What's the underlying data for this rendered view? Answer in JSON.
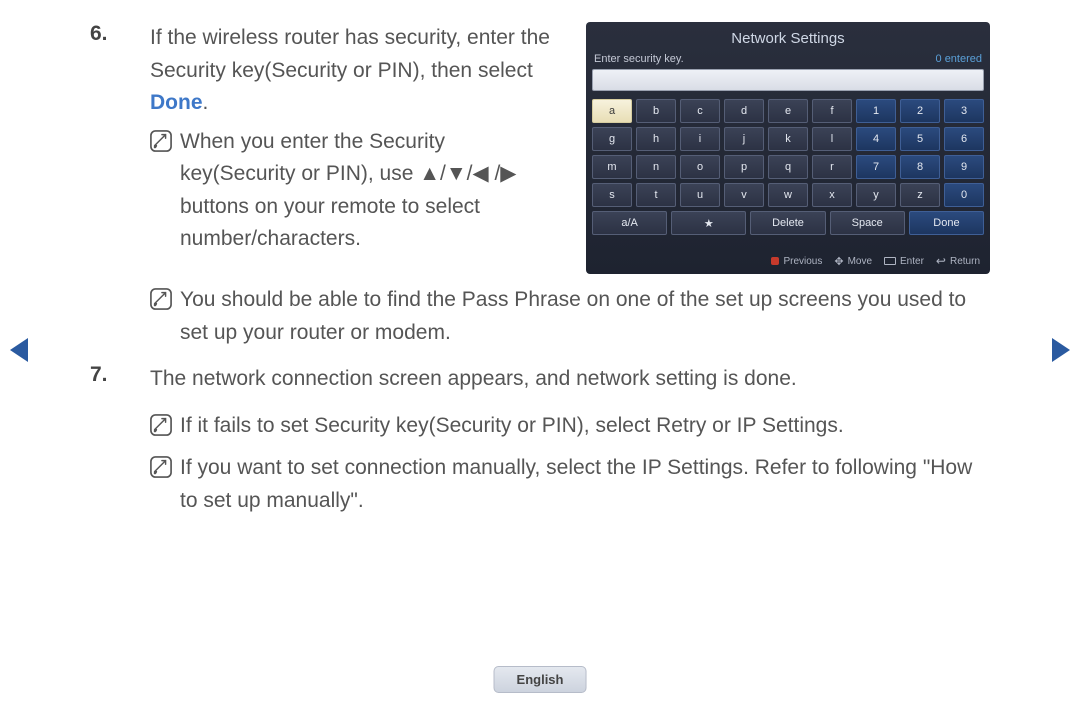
{
  "nav": {
    "prev": "◀",
    "next": "▶"
  },
  "step6": {
    "num": "6.",
    "text_a": "If the wireless router has security, enter the Security key(Security or PIN), then select ",
    "text_done": "Done",
    "text_b": ".",
    "note1_a": "When you enter the Security key(Security or PIN), use ▲/▼/◀ /▶ buttons on your remote to select number/characters.",
    "note2_a": "You should be able to find the Pass Phrase on one of the set up screens you used to set up your router or modem."
  },
  "step7": {
    "num": "7.",
    "text": "The network connection screen appears, and network setting is done.",
    "note1_a": "If it fails to set Security key(Security or PIN), select ",
    "note1_retry": "Retry",
    "note1_or": " or ",
    "note1_ip": "IP Settings",
    "note1_b": ".",
    "note2_a": "If you want to set connection manually, select the ",
    "note2_ip": "IP Settings",
    "note2_b": ". Refer to following \"How to set up manually\"."
  },
  "osk": {
    "title": "Network Settings",
    "label": "Enter security key.",
    "count": "0 entered",
    "rows": [
      [
        "a",
        "b",
        "c",
        "d",
        "e",
        "f",
        "1",
        "2",
        "3"
      ],
      [
        "g",
        "h",
        "i",
        "j",
        "k",
        "l",
        "4",
        "5",
        "6"
      ],
      [
        "m",
        "n",
        "o",
        "p",
        "q",
        "r",
        "7",
        "8",
        "9"
      ],
      [
        "s",
        "t",
        "u",
        "v",
        "w",
        "x",
        "y",
        "z",
        "0"
      ]
    ],
    "bottom": [
      "a/A",
      "★",
      "Delete",
      "Space",
      "Done"
    ],
    "hints": {
      "previous": "Previous",
      "move": "Move",
      "enter": "Enter",
      "ret": "Return"
    }
  },
  "language": "English"
}
